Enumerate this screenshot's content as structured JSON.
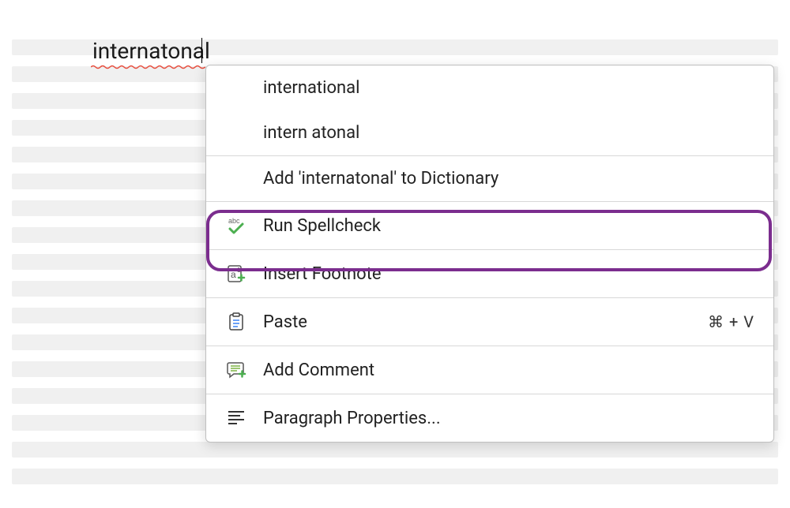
{
  "document": {
    "typed_word": "internatonal"
  },
  "context_menu": {
    "suggestions": [
      "international",
      "intern atonal"
    ],
    "add_to_dictionary": "Add 'internatonal' to Dictionary",
    "run_spellcheck": "Run Spellcheck",
    "insert_footnote": "Insert Footnote",
    "paste": "Paste",
    "paste_shortcut": "⌘ + V",
    "add_comment": "Add Comment",
    "paragraph_properties": "Paragraph Properties..."
  }
}
